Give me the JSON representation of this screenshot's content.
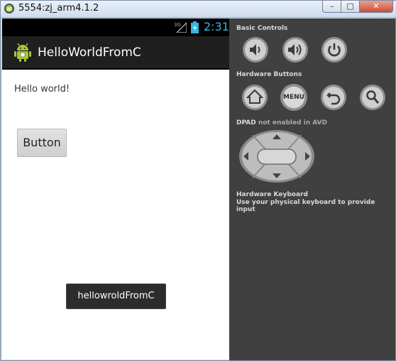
{
  "window": {
    "title": "5554:zj_arm4.1.2"
  },
  "status_bar": {
    "network": "3G",
    "time": "2:31"
  },
  "app": {
    "title": "HelloWorldFromC",
    "hello_text": "Hello world!",
    "button_label": "Button",
    "toast_text": "hellowroldFromC"
  },
  "controls": {
    "basic_controls_heading": "Basic Controls",
    "hardware_buttons_heading": "Hardware Buttons",
    "menu_label": "MENU",
    "dpad_heading": "DPAD",
    "dpad_note": "not enabled in AVD",
    "keyboard_heading": "Hardware Keyboard",
    "keyboard_note": "Use your physical keyboard to provide input"
  },
  "colors": {
    "clock": "#33b5e5",
    "panel": "#404040",
    "action_bar": "#1f1f1f",
    "toast": "#2b2d2b"
  }
}
